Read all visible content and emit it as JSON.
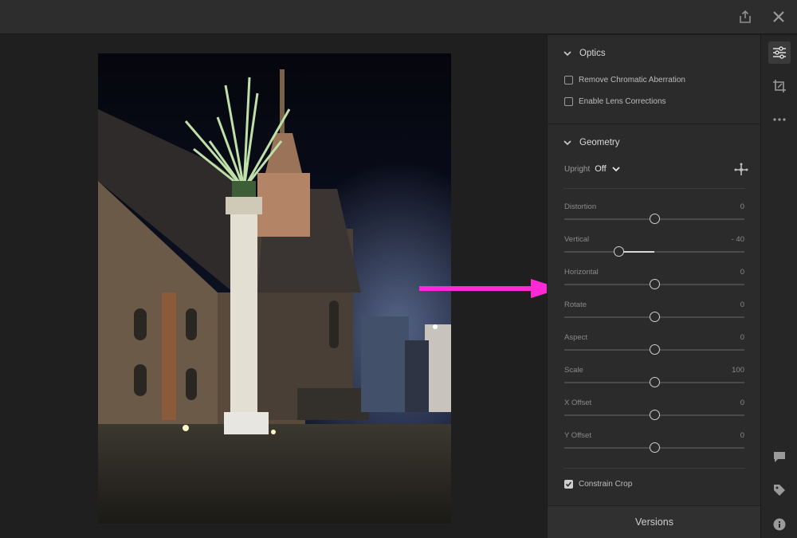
{
  "optics": {
    "title": "Optics",
    "remove_chromatic_aberration": {
      "label": "Remove Chromatic Aberration",
      "checked": false
    },
    "enable_lens_corrections": {
      "label": "Enable Lens Corrections",
      "checked": false
    }
  },
  "geometry": {
    "title": "Geometry",
    "upright_label": "Upright",
    "upright_value": "Off",
    "sliders": [
      {
        "label": "Distortion",
        "value": "0",
        "num": 0,
        "min": -100,
        "max": 100
      },
      {
        "label": "Vertical",
        "value": "- 40",
        "num": -40,
        "min": -100,
        "max": 100
      },
      {
        "label": "Horizontal",
        "value": "0",
        "num": 0,
        "min": -100,
        "max": 100
      },
      {
        "label": "Rotate",
        "value": "0",
        "num": 0,
        "min": -10,
        "max": 10
      },
      {
        "label": "Aspect",
        "value": "0",
        "num": 0,
        "min": -100,
        "max": 100
      },
      {
        "label": "Scale",
        "value": "100",
        "num": 100,
        "min": 50,
        "max": 150
      },
      {
        "label": "X Offset",
        "value": "0",
        "num": 0,
        "min": -100,
        "max": 100
      },
      {
        "label": "Y Offset",
        "value": "0",
        "num": 0,
        "min": -100,
        "max": 100
      }
    ],
    "constrain_crop": {
      "label": "Constrain Crop",
      "checked": true
    }
  },
  "versions_label": "Versions",
  "icons": {
    "share": "share-icon",
    "close": "close-icon",
    "edit": "sliders-icon",
    "crop": "crop-icon",
    "more": "more-icon",
    "comment": "comment-icon",
    "tag": "tag-icon",
    "info": "info-icon",
    "guided_upright": "guided-upright-icon"
  },
  "colors": {
    "annotation_arrow": "#ff29d6",
    "panel": "#2b2b2b",
    "background": "#1f1f1f"
  }
}
